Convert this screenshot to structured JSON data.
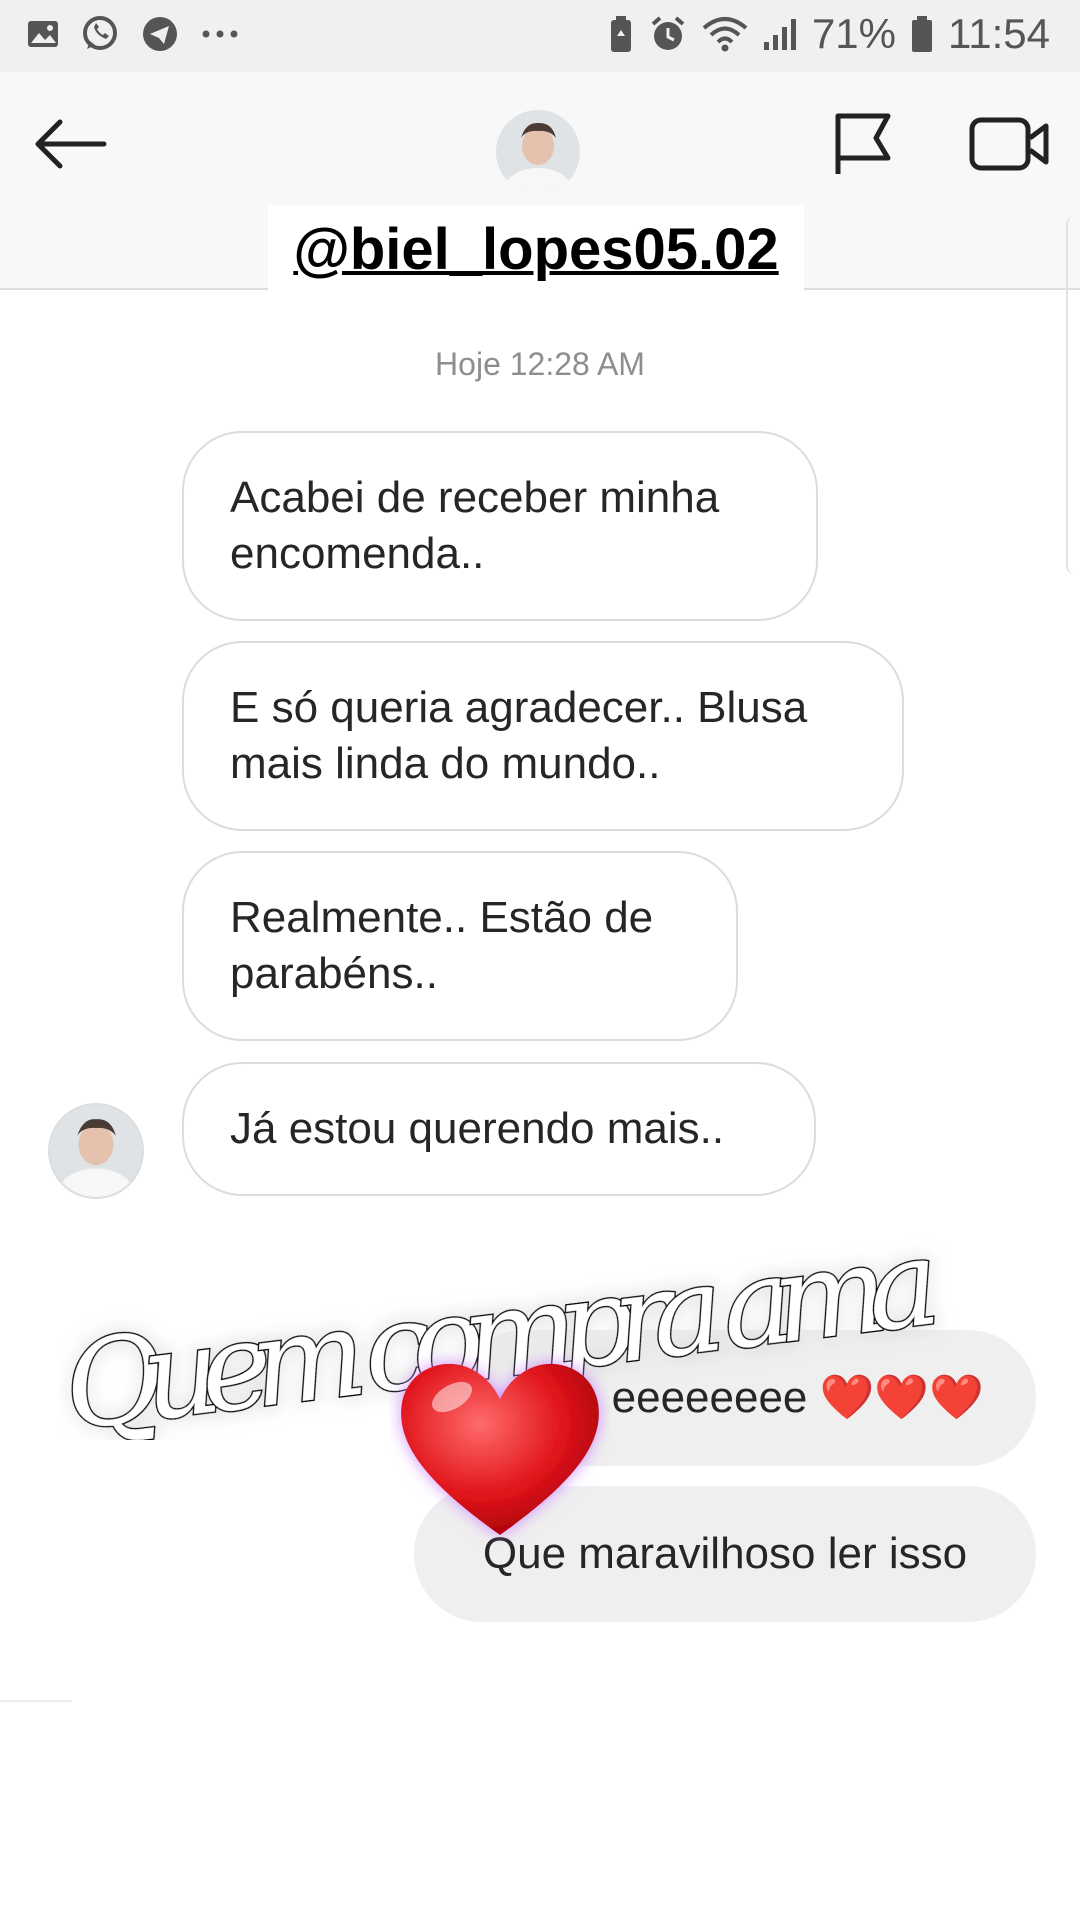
{
  "status_bar": {
    "battery": "71%",
    "time": "11:54",
    "left_icons": [
      "gallery-icon",
      "whatsapp-icon",
      "telegram-icon",
      "more-dots-icon"
    ],
    "right_icons": [
      "battery-saver-icon",
      "alarm-icon",
      "wifi-icon",
      "signal-icon",
      "battery-icon"
    ]
  },
  "header": {
    "username_sticker": "@biel_lopes05.02",
    "icons": [
      "back-arrow-icon",
      "flag-icon",
      "video-camera-icon"
    ]
  },
  "conversation": {
    "timestamp": "Hoje 12:28 AM",
    "incoming": [
      {
        "line1": "Acabei de receber minha",
        "line2": "encomenda.."
      },
      {
        "line1": "E só queria agradecer.. Blusa",
        "line2": "mais linda do mundo.."
      },
      {
        "line1": "Realmente.. Estão de",
        "line2": "parabéns.."
      },
      {
        "line1": "Já estou querendo mais.."
      }
    ],
    "outgoing": [
      {
        "text": "eeeeeeee ❤️❤️❤️"
      },
      {
        "text": "Que maravilhoso ler isso"
      }
    ]
  },
  "overlay": {
    "script_text": "Quem compra ama",
    "sticker": "heart-icon"
  },
  "colors": {
    "status_bar_bg": "#f0f0f0",
    "appbar_bg": "#f8f8f8",
    "outgoing_bubble": "#efefef",
    "incoming_border": "#dcdcdc",
    "heart_red": "#e0141b",
    "glow_purple": "#c774ff"
  }
}
